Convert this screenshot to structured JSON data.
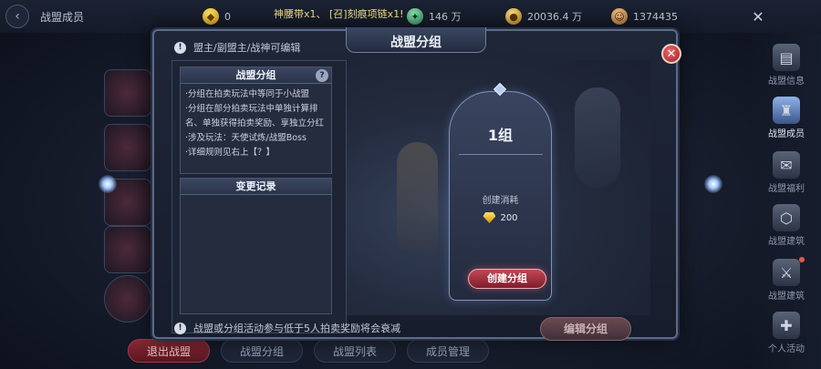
{
  "topbar": {
    "back_icon": "back-arrow-icon",
    "title": "战盟成员",
    "resources": [
      {
        "icon": "gem-icon",
        "value": "0"
      },
      {
        "icon": "green-crystal-icon",
        "value": "146 万"
      },
      {
        "icon": "gold-coin-icon",
        "value": "20036.4 万"
      },
      {
        "icon": "avatar-icon",
        "value": "1374435"
      }
    ],
    "marquee": "神腰带x1、 [召]刻痕项链x1!",
    "close_label": "✕"
  },
  "sidebar": {
    "items": [
      {
        "label": "战盟信息",
        "icon": "alliance-info-icon",
        "active": false
      },
      {
        "label": "战盟成员",
        "icon": "alliance-members-icon",
        "active": true
      },
      {
        "label": "战盟福利",
        "icon": "alliance-welfare-icon",
        "active": false
      },
      {
        "label": "战盟建筑",
        "icon": "alliance-building-icon",
        "active": false
      },
      {
        "label": "战盟建筑",
        "icon": "alliance-battle-icon",
        "active": false,
        "badge": true
      },
      {
        "label": "个人活动",
        "icon": "personal-activity-icon",
        "active": false
      }
    ]
  },
  "bottom_tabs": [
    "退出战盟",
    "战盟分组",
    "战盟列表",
    "成员管理"
  ],
  "dialog": {
    "title": "战盟分组",
    "top_note": "盟主/副盟主/战神可编辑",
    "bottom_note": "战盟或分组活动参与低于5人拍卖奖励将会衰减",
    "info_box": {
      "title": "战盟分组",
      "help": "?",
      "lines": [
        "·分组在拍卖玩法中等同于小战盟",
        "·分组在部分拍卖玩法中单独计算排名、单独获得拍卖奖励、享独立分红",
        "·涉及玩法：天使试炼/战盟Boss",
        "·详细规则见右上【？】"
      ]
    },
    "log_box": {
      "title": "变更记录"
    },
    "group_card": {
      "title": "1组",
      "cost_label": "创建消耗",
      "cost_icon": "gem-icon",
      "cost_value": "200",
      "create_button": "创建分组"
    },
    "edit_button": "编辑分组",
    "close_icon": "close-icon"
  },
  "colors": {
    "accent_red": "#c34756",
    "panel_border": "#5c6b89",
    "gold": "#f2e08a"
  }
}
